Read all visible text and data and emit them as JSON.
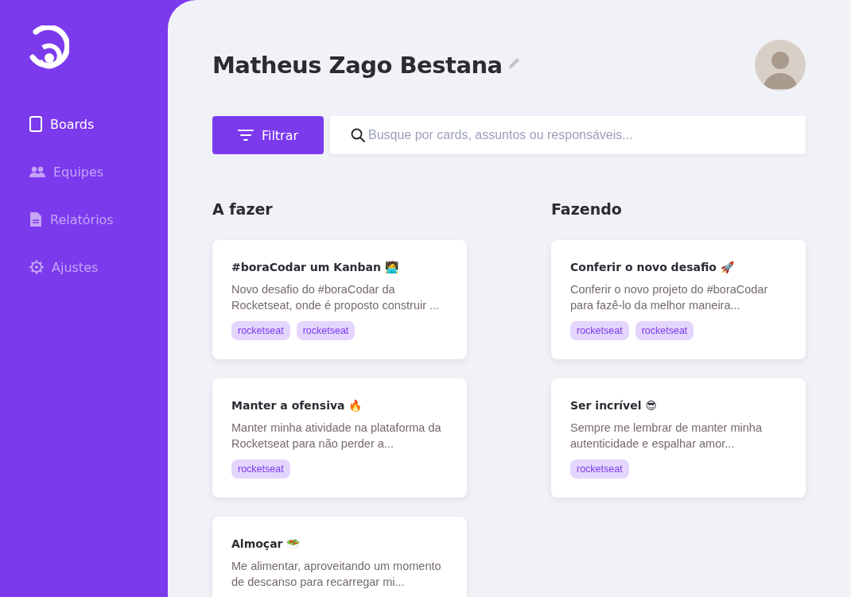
{
  "sidebar": {
    "items": [
      {
        "label": "Boards",
        "selected": true
      },
      {
        "label": "Equipes",
        "selected": false
      },
      {
        "label": "Relatórios",
        "selected": false
      },
      {
        "label": "Ajustes",
        "selected": false
      }
    ]
  },
  "header": {
    "title": "Matheus Zago Bestana"
  },
  "toolbar": {
    "filter_button": "Filtrar",
    "search": {
      "placeholder": "Busque por cards, assuntos ou responsáveis..."
    }
  },
  "columns": [
    {
      "title": "A fazer",
      "cards": [
        {
          "title": "#boraCodar um Kanban 🧑‍💻",
          "description": "Novo desafio do #boraCodar da Rocketseat, onde é proposto construir ...",
          "tags": [
            "rocketseat",
            "rocketseat"
          ]
        },
        {
          "title": "Manter a ofensiva 🔥",
          "description": "Manter minha atividade na plataforma da Rocketseat para não perder a...",
          "tags": [
            "rocketseat"
          ]
        },
        {
          "title": "Almoçar 🥗",
          "description": "Me alimentar, aproveitando um momento de descanso para recarregar mi..."
        }
      ]
    },
    {
      "title": "Fazendo",
      "cards": [
        {
          "title": "Conferir o novo desafio 🚀",
          "description": "Conferir o novo projeto do #boraCodar para fazê-lo da melhor maneira...",
          "tags": [
            "rocketseat",
            "rocketseat"
          ]
        },
        {
          "title": "Ser incrível 😎",
          "description": "Sempre me lembrar de manter minha autenticidade e espalhar amor...",
          "tags": [
            "rocketseat"
          ]
        }
      ]
    }
  ]
}
